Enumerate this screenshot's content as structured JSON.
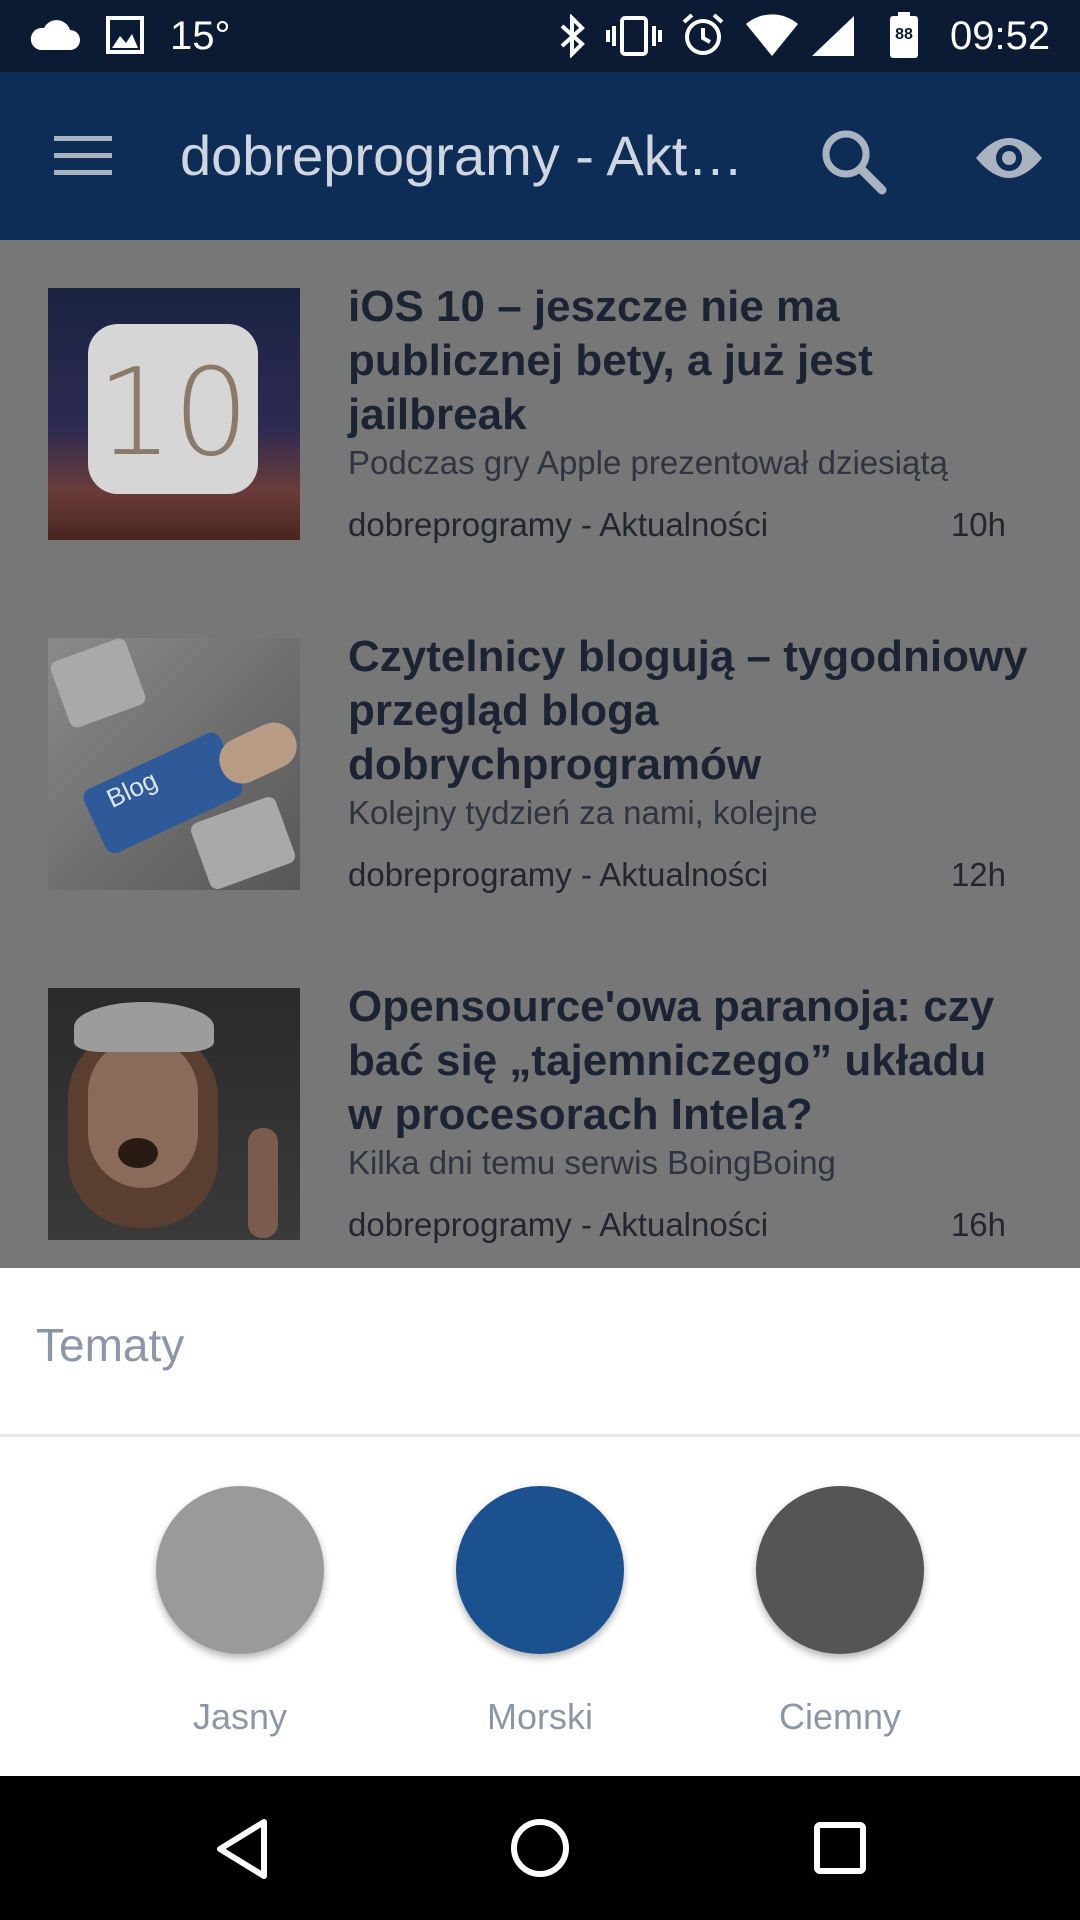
{
  "status_bar": {
    "temperature": "15°",
    "time": "09:52",
    "battery": "88",
    "icons": [
      "cloud-icon",
      "image-icon",
      "bluetooth-icon",
      "vibrate-icon",
      "alarm-icon",
      "wifi-icon",
      "signal-icon",
      "battery-icon"
    ]
  },
  "app_bar": {
    "title": "dobreprogramy - Aktualności",
    "icons": [
      "menu-icon",
      "search-icon",
      "eye-icon"
    ]
  },
  "articles": [
    {
      "title": "iOS 10 – jeszcze nie ma publicznej bety, a już jest jailbreak",
      "snippet": "Podczas gry Apple prezentował dziesiątą",
      "source": "dobreprogramy - Aktualności",
      "age": "10h",
      "thumb_text": "10"
    },
    {
      "title": "Czytelnicy blogują – tygodniowy przegląd bloga dobrychprogramów",
      "snippet": "Kolejny tydzień za nami, kolejne",
      "source": "dobreprogramy - Aktualności",
      "age": "12h",
      "thumb_text": "Blog"
    },
    {
      "title": "Opensource'owa paranoja: czy bać się „tajemniczego” układu w procesorach Intela?",
      "snippet": "Kilka dni temu serwis BoingBoing",
      "source": "dobreprogramy - Aktualności",
      "age": "16h"
    }
  ],
  "theme_sheet": {
    "title": "Tematy",
    "options": [
      {
        "label": "Jasny",
        "color": "#9a9a9a"
      },
      {
        "label": "Morski",
        "color": "#1c5190"
      },
      {
        "label": "Ciemny",
        "color": "#555555"
      }
    ]
  },
  "nav_bar": {
    "icons": [
      "back-icon",
      "home-icon",
      "recents-icon"
    ]
  },
  "colors": {
    "status_bar": "#0b1b33",
    "app_bar": "#0d2c56",
    "scrim_content": "#777777",
    "sheet_text": "#8c96a8"
  }
}
